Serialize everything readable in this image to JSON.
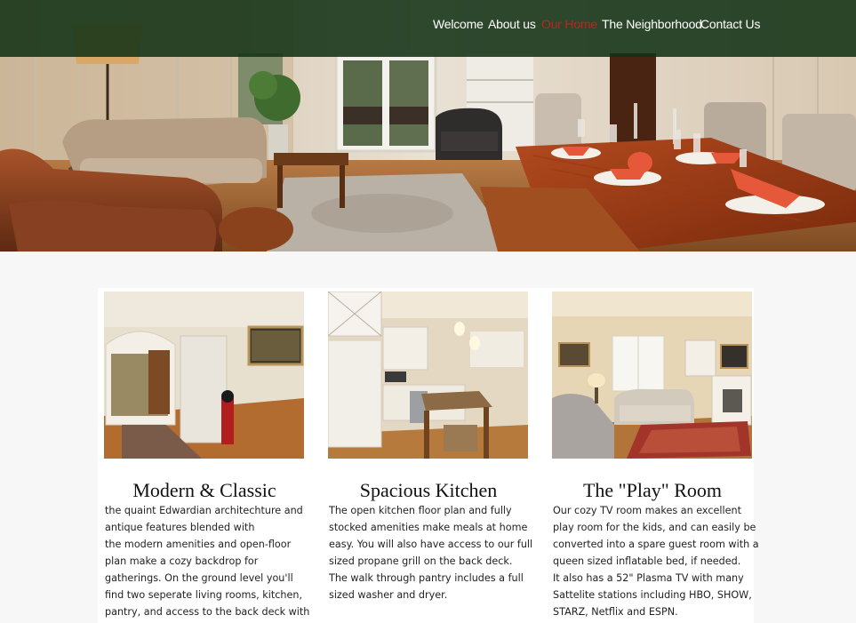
{
  "nav": {
    "items": [
      {
        "label": "Welcome",
        "active": false
      },
      {
        "label": "About us",
        "active": false
      },
      {
        "label": "Our Home",
        "active": true
      },
      {
        "label": "The Neighborhood",
        "active": false
      },
      {
        "label": "Contact Us",
        "active": false
      }
    ]
  },
  "colors": {
    "nav_background": "#123216",
    "active_link": "#c0241c",
    "page_background": "#f7f7f7"
  },
  "cards": [
    {
      "title": "Modern & Classic",
      "lines": [
        "the quaint Edwardian architechture and",
        "antique features blended with",
        "the modern amenities and open-floor",
        "plan make a cozy backdrop for",
        "gatherings. On the ground level you'll",
        "find two seperate living rooms, kitchen,",
        "pantry, and access to the back deck with"
      ]
    },
    {
      "title": "Spacious Kitchen",
      "lines": [
        "The open kitchen floor plan and fully",
        "stocked amenities make meals at home",
        "easy. You will also have access to our full",
        "sized propane grill on the back deck.",
        "The walk through pantry includes a full",
        "sized washer and dryer."
      ]
    },
    {
      "title": "The \"Play\" Room",
      "lines": [
        "Our cozy TV room makes an excellent",
        "play room for the kids, and can easily be",
        "converted into a spare guest room with a",
        "queen sized inflatable bed, if needed.",
        "It also has a 52\" Plasma TV with many",
        "Sattelite stations including HBO, SHOW,",
        "STARZ, Netflix and ESPN."
      ]
    }
  ]
}
